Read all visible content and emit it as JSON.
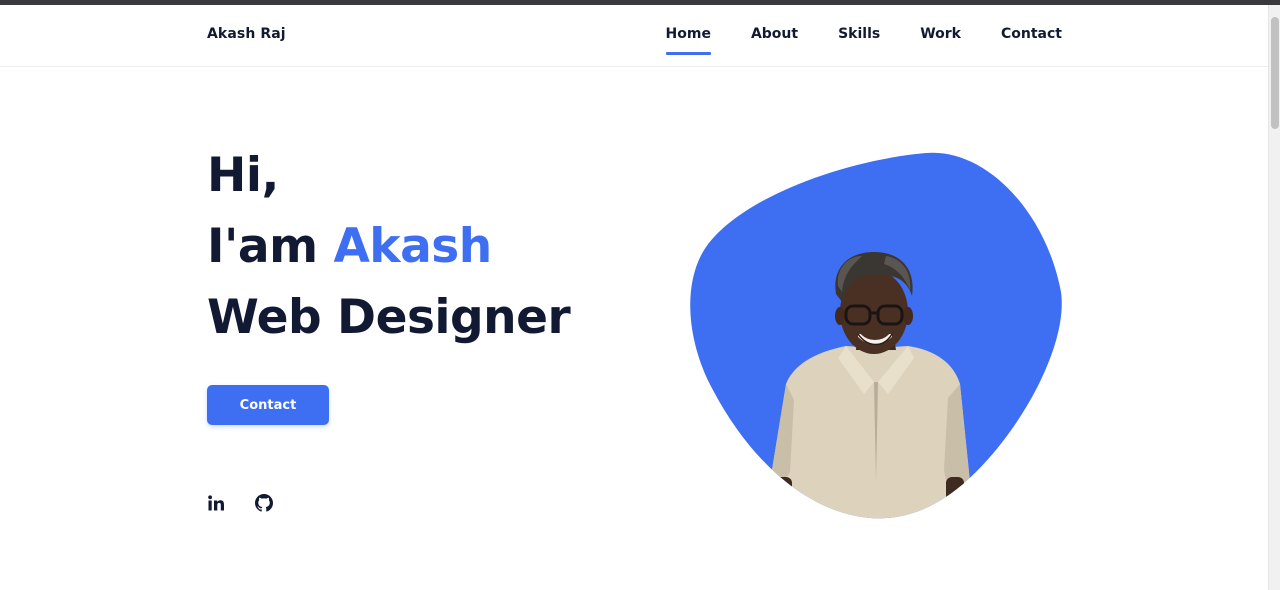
{
  "header": {
    "logo": "Akash Raj",
    "nav": [
      {
        "label": "Home",
        "active": true
      },
      {
        "label": "About",
        "active": false
      },
      {
        "label": "Skills",
        "active": false
      },
      {
        "label": "Work",
        "active": false
      },
      {
        "label": "Contact",
        "active": false
      }
    ]
  },
  "hero": {
    "line1": "Hi,",
    "line2_prefix": "I'am ",
    "line2_name": "Akash",
    "line3": "Web Designer",
    "button_label": "Contact"
  },
  "social": {
    "icons": [
      "linkedin-icon",
      "github-icon"
    ]
  },
  "colors": {
    "accent": "#3e6ff2",
    "text": "#121a33",
    "background": "#ffffff"
  }
}
